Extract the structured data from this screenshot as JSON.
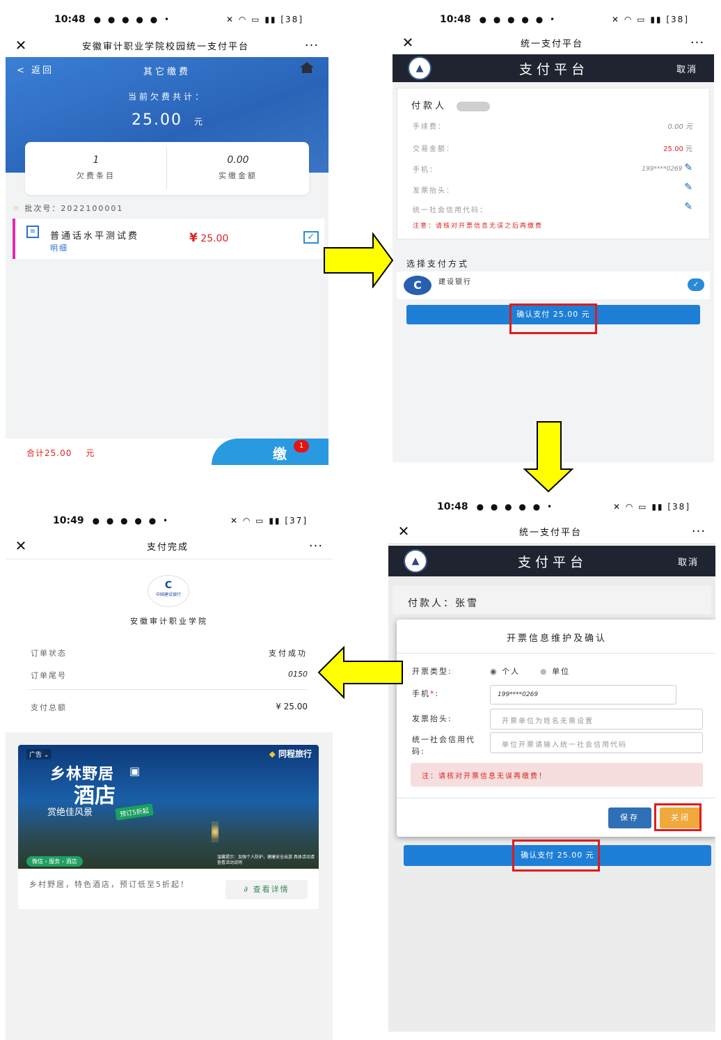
{
  "status_bar": {
    "time_1": "10:48",
    "time_2": "10:48",
    "time_3": "10:48",
    "time_4": "10:49",
    "battery_1": "38",
    "battery_2": "38",
    "battery_3": "38",
    "battery_4": "37"
  },
  "screen1": {
    "window_title": "安徽审计职业学院校园统一支付平台",
    "back_label": "返回",
    "header_title": "其它缴费",
    "arrears_label": "当前欠费共计：",
    "amount": "25.00",
    "amount_unit": "元",
    "stat_count": "1",
    "stat_count_label": "欠费条目",
    "stat_paid": "0.00",
    "stat_paid_label": "实缴金额",
    "batch_label": "批次号：2022100001",
    "item_name": "普通话水平测试费",
    "item_detail": "明细",
    "item_currency": "¥",
    "item_amount": "25.00",
    "footer_total": "合计25.00",
    "footer_unit": "元",
    "pay_badge": "1"
  },
  "screen2": {
    "window_title": "统一支付平台",
    "bar_title": "支付平台",
    "cancel": "取消",
    "payer_label": "付款人",
    "fee_label": "手续费：",
    "fee_value": "0.00 元",
    "trade_label": "交易金额：",
    "trade_value": "25.00",
    "trade_unit": "元",
    "phone_label": "手机：",
    "phone_value": "199****0269",
    "invoice_label": "发票抬头：",
    "credit_label": "统一社会信用代码：",
    "notice": "注意：请核对开票信息无误之后再缴费",
    "method_title": "选择支付方式",
    "bank_name": "建设银行",
    "confirm": "确认支付 25.00 元"
  },
  "screen3": {
    "window_title": "统一支付平台",
    "bar_title": "支付平台",
    "cancel": "取消",
    "payer": "付款人：张雪",
    "modal_title": "开票信息维护及确认",
    "type_label": "开票类型:",
    "type_personal": "个人",
    "type_unit": "单位",
    "phone_label": "手机",
    "phone_value": "199****0269",
    "invoice_label": "发票抬头:",
    "invoice_placeholder": "开票单位为姓名无需设置",
    "credit_label": "统一社会信用代码:",
    "credit_placeholder": "单位开票请输入统一社会信用代码",
    "notice": "注：请核对开票信息无误再缴费！",
    "save": "保存",
    "close": "关闭",
    "confirm": "确认支付 25.00 元"
  },
  "screen4": {
    "window_title": "支付完成",
    "bank_logo_text": "中国建设银行",
    "merchant": "安徽审计职业学院",
    "status_label": "订单状态",
    "status_value": "支付成功",
    "tail_label": "订单尾号",
    "tail_value": "0150",
    "total_label": "支付总额",
    "total_value": "¥ 25.00",
    "ad_tag": "广告",
    "ad_brand": "同程旅行",
    "ad_headline_1": "乡林野居",
    "ad_headline_2": "酒店",
    "ad_sub": "赏绝佳风景",
    "ad_promo": "预订5折起",
    "ad_path": "微信 › 服务 › 酒店",
    "ad_tip": "温馨提示：加强个人防护，健康安全出游 具体活动请查看活动说明",
    "ad_desc": "乡村野居，特色酒店，预订低至5折起！",
    "ad_button": "查看详情"
  },
  "colors": {
    "blue_header": "#2f6fc6",
    "confirm_blue": "#1e7fd6",
    "red": "#e01b1b",
    "arrow_yellow": "#ffff00",
    "dark_bar": "#1f2430",
    "close_orange": "#f0a93c",
    "save_blue": "#2f6fb5"
  }
}
